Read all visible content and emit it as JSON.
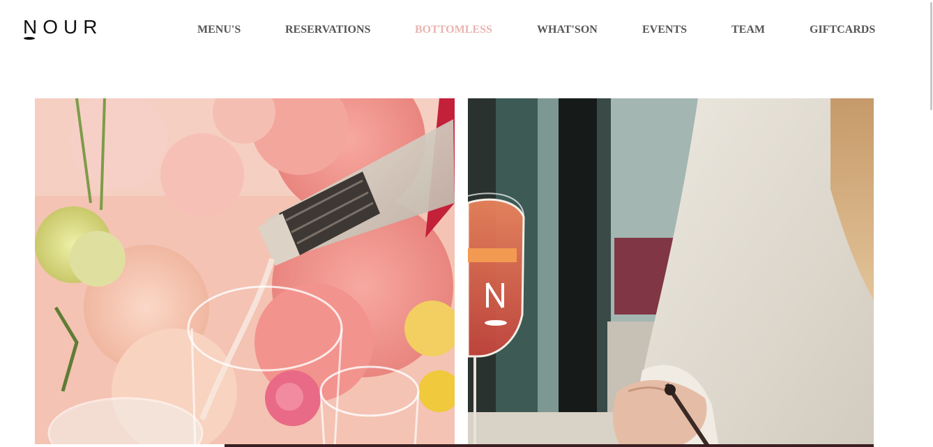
{
  "header": {
    "logo_text": "NOUR",
    "nav": [
      {
        "label": "MENU'S",
        "active": false
      },
      {
        "label": "RESERVATIONS",
        "active": false
      },
      {
        "label": "BOTTOMLESS",
        "active": true
      },
      {
        "label": "WHAT'SON",
        "active": false
      },
      {
        "label": "EVENTS",
        "active": false
      },
      {
        "label": "TEAM",
        "active": false
      },
      {
        "label": "GIFTCARDS",
        "active": false
      }
    ]
  },
  "colors": {
    "nav_text": "#555555",
    "nav_active": "#eab4b0",
    "logo": "#111111"
  },
  "gallery": [
    {
      "subject": "champagne pouring into glasses in front of pink flowers"
    },
    {
      "subject": "woman holding spritz cocktail glass with N logo"
    }
  ]
}
